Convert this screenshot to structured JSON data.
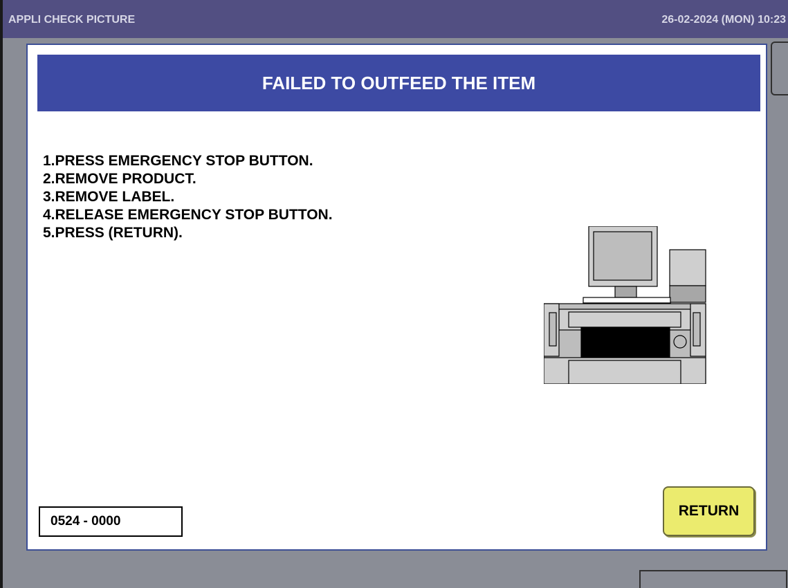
{
  "titlebar": {
    "title": "APPLI CHECK PICTURE",
    "datetime": "26-02-2024 (MON)  10:23"
  },
  "dialog": {
    "header": "FAILED TO OUTFEED THE ITEM",
    "instructions": [
      "1.PRESS EMERGENCY STOP BUTTON.",
      "2.REMOVE PRODUCT.",
      "3.REMOVE LABEL.",
      "4.RELEASE EMERGENCY STOP BUTTON.",
      "5.PRESS (RETURN)."
    ],
    "error_code": "0524 - 0000",
    "return_label": "RETURN",
    "illustration_icon": "labeling-machine-icon"
  },
  "colors": {
    "titlebar_bg": "#524f82",
    "header_bg": "#3d4aa3",
    "screen_bg": "#8a8d96",
    "return_button_bg": "#ebeb6e"
  }
}
